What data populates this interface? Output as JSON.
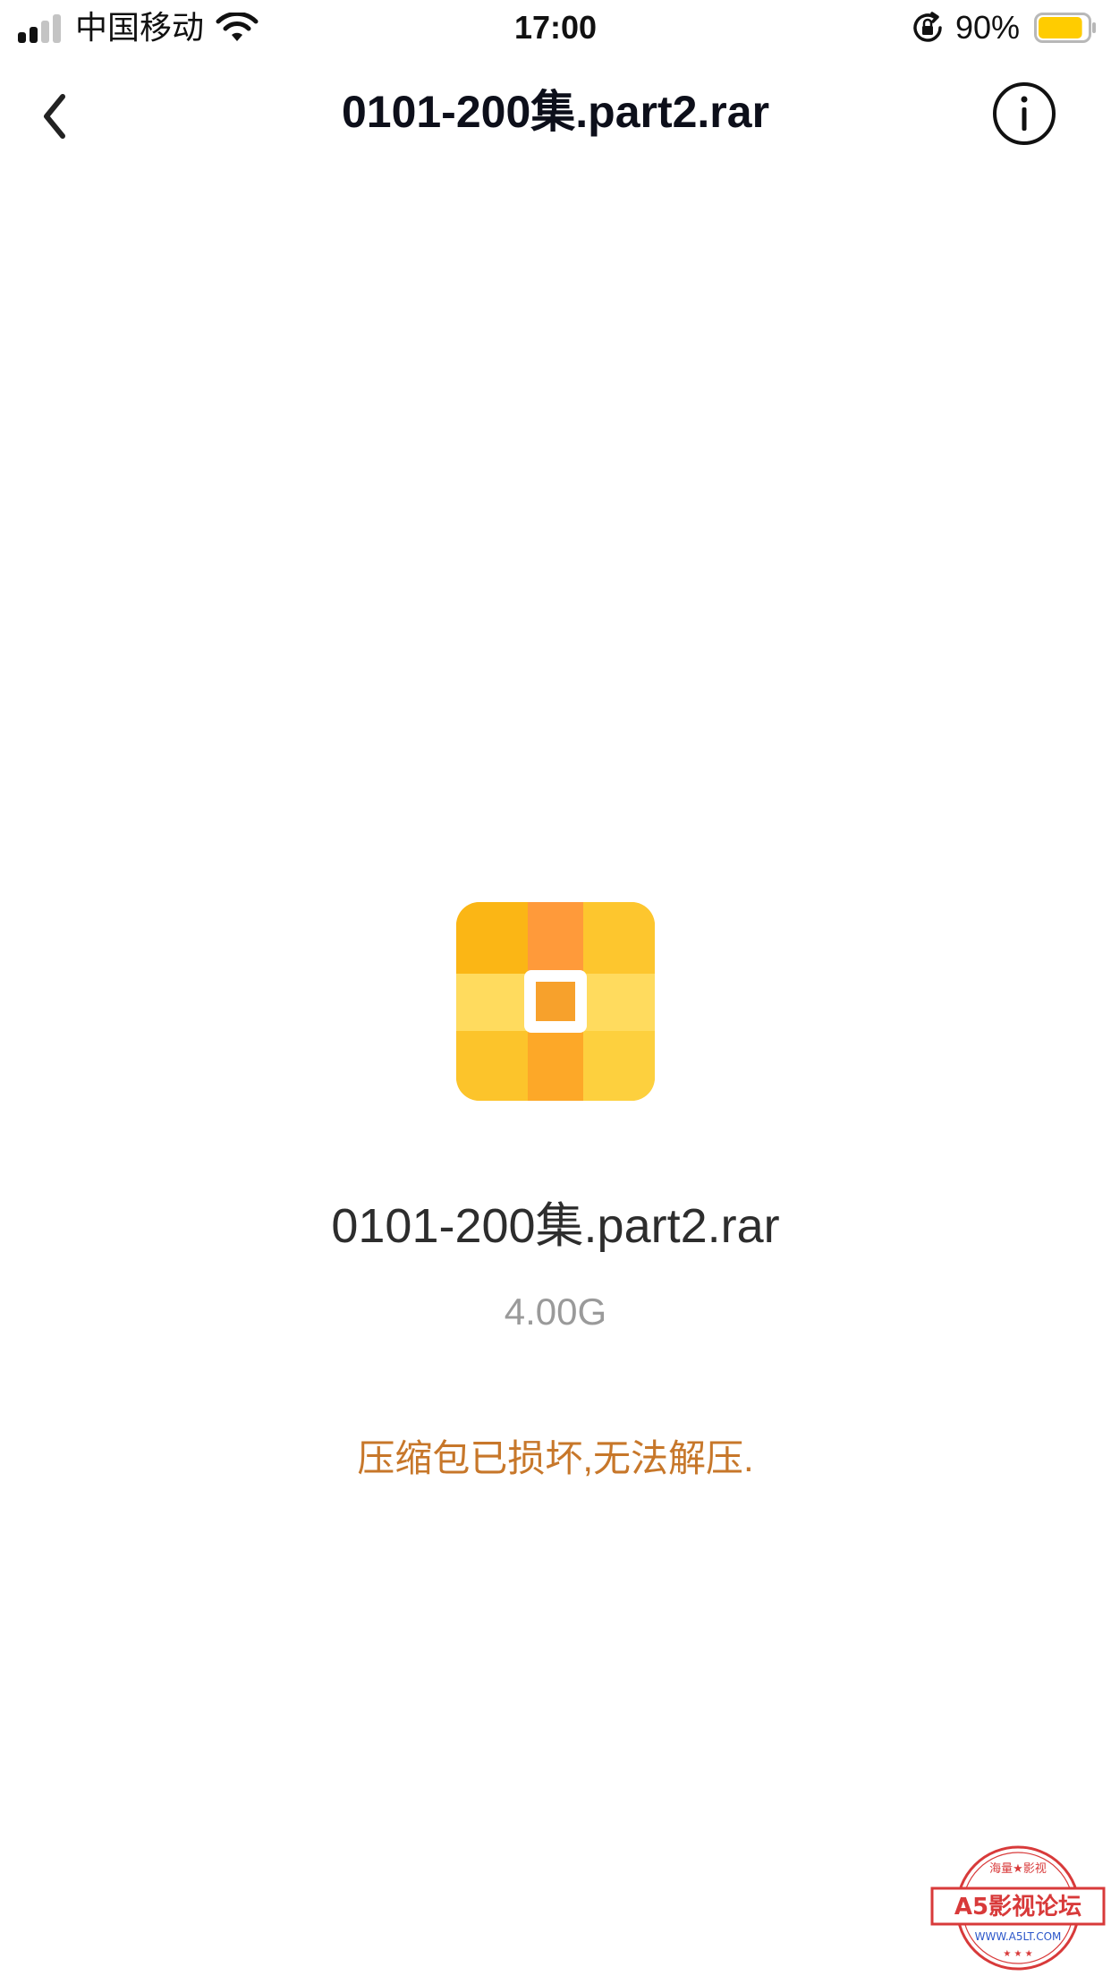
{
  "status_bar": {
    "carrier": "中国移动",
    "time": "17:00",
    "battery_percent": "90%",
    "signal_bars_filled": 2,
    "signal_bars_total": 4,
    "battery_level": 0.9
  },
  "nav": {
    "title": "0101-200集.part2.rar",
    "back_icon": "chevron-left-icon",
    "info_icon": "info-circle-icon"
  },
  "file": {
    "name": "0101-200集.part2.rar",
    "size": "4.00G",
    "icon": "archive-icon"
  },
  "error": {
    "message": "压缩包已损坏,无法解压."
  },
  "watermark": {
    "text_top": "海量★影视",
    "text_main": "A5影视论坛",
    "text_bottom": "WWW.A5LT.COM"
  },
  "colors": {
    "error": "#c7772a",
    "battery": "#ffcc00",
    "watermark": "#d83a3a",
    "icon_gold": "#fbb615",
    "icon_orange": "#ff9a3a"
  }
}
